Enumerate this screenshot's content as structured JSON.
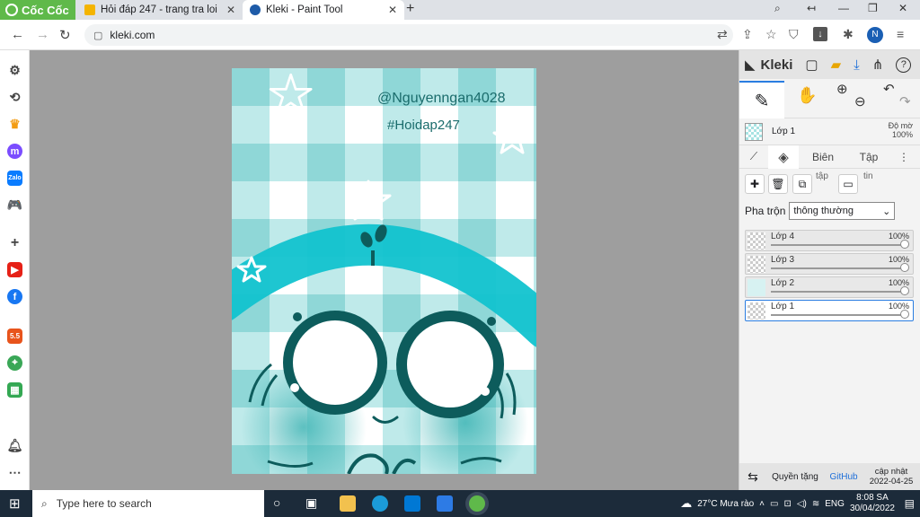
{
  "browser": {
    "brand": "Cốc Cốc",
    "tabs": [
      {
        "title": "Hỏi đáp 247 - trang tra loi",
        "icon": "hoidap-icon",
        "active": false
      },
      {
        "title": "Kleki - Paint Tool",
        "icon": "kleki-icon",
        "active": true
      }
    ],
    "url": "kleki.com"
  },
  "canvas_art": {
    "watermark_handle": "@Nguyennga​n4028",
    "watermark_tag": "#Hoidap247"
  },
  "kleki": {
    "title": "Kleki",
    "current_layer": "Lớp 1",
    "opacity_label": "Độ mờ",
    "opacity_value": "100%",
    "tabs": [
      "Biên",
      "Tập"
    ],
    "action_labels": {
      "merge": "tập",
      "info": "tin"
    },
    "blend_label": "Pha trộn",
    "blend_value": "thông thường",
    "layers": [
      {
        "name": "Lớp 4",
        "opacity": "100%"
      },
      {
        "name": "Lớp 3",
        "opacity": "100%"
      },
      {
        "name": "Lớp 2",
        "opacity": "100%"
      },
      {
        "name": "Lớp 1",
        "opacity": "100%"
      }
    ],
    "footer": {
      "privacy": "Quyền tặng",
      "github": "GitHub",
      "update": "cập nhật",
      "date": "2022-04-25"
    }
  },
  "taskbar": {
    "search_placeholder": "Type here to search",
    "weather": "27°C  Mưa rào",
    "lang": "ENG",
    "time": "8:08 SA",
    "date": "30/04/2022"
  }
}
